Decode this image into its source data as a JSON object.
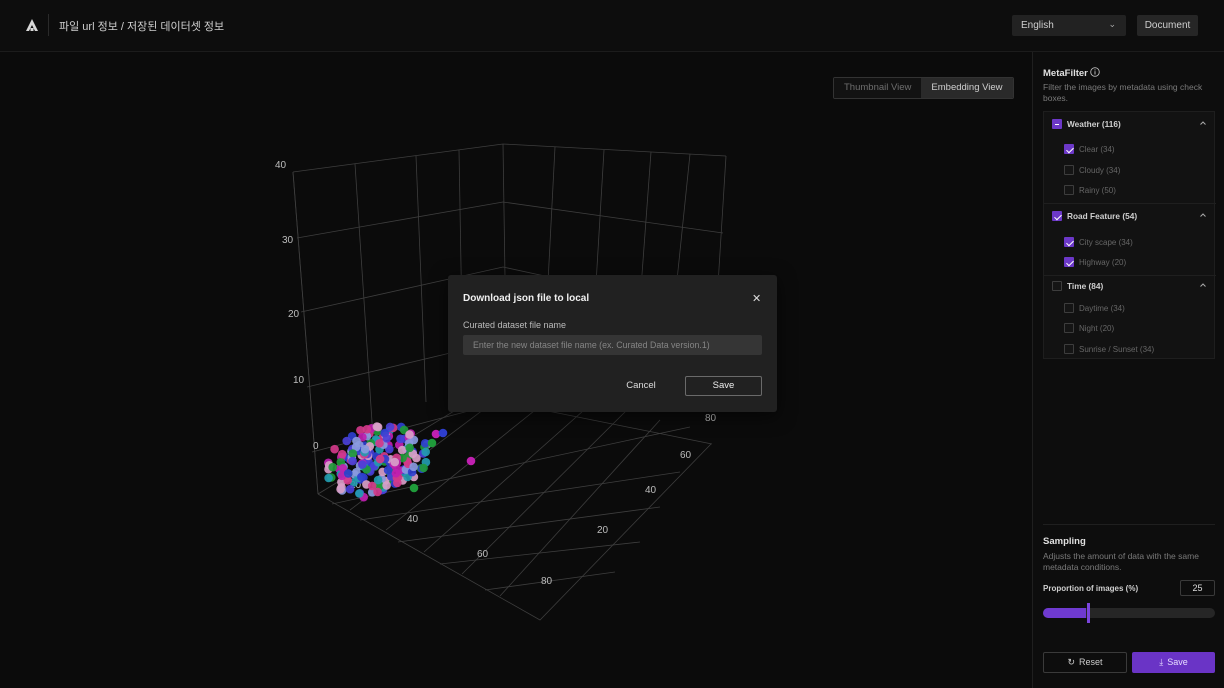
{
  "header": {
    "breadcrumb": "파일 url 정보 / 저장된 데이터셋 정보",
    "language": "English",
    "document_label": "Document"
  },
  "view_toggle": {
    "thumbnail_label": "Thumbnail View",
    "embedding_label": "Embedding View",
    "active": "Embedding View"
  },
  "chart_data": {
    "type": "scatter",
    "projection": "3d",
    "z_ticks": [
      "0",
      "10",
      "20",
      "30",
      "40"
    ],
    "x_ticks": [
      "20",
      "40",
      "60",
      "80"
    ],
    "y_ticks": [
      "20",
      "40",
      "60",
      "80"
    ],
    "grid": true,
    "series_colors": [
      "#c020b0",
      "#2f3fcf",
      "#d23a8a",
      "#4a40d8",
      "#1f9a3a",
      "#d8a0c8",
      "#8a9adf",
      "#239bb0"
    ]
  },
  "modal": {
    "title": "Download json file to local",
    "close_icon": "close-icon",
    "field_label": "Curated dataset file name",
    "field_placeholder": "Enter the new dataset file name (ex. Curated Data version.1)",
    "field_value": "",
    "cancel_label": "Cancel",
    "save_label": "Save"
  },
  "metafilter": {
    "title": "MetaFilter",
    "description": "Filter the images by metadata using check boxes.",
    "groups": [
      {
        "label": "Weather (116)",
        "state": "partial",
        "options": [
          {
            "label": "Clear (34)",
            "checked": true
          },
          {
            "label": "Cloudy (34)",
            "checked": false
          },
          {
            "label": "Rainy (50)",
            "checked": false
          }
        ]
      },
      {
        "label": "Road Feature (54)",
        "state": "checked",
        "options": [
          {
            "label": "City scape (34)",
            "checked": true
          },
          {
            "label": "Highway (20)",
            "checked": true
          }
        ]
      },
      {
        "label": "Time (84)",
        "state": "unchecked",
        "options": [
          {
            "label": "Daytime (34)",
            "checked": false
          },
          {
            "label": "Night (20)",
            "checked": false
          },
          {
            "label": "Sunrise / Sunset (34)",
            "checked": false
          }
        ]
      }
    ]
  },
  "sampling": {
    "title": "Sampling",
    "description": "Adjusts the amount of data with the same metadata conditions.",
    "proportion_label": "Proportion of images (%)",
    "proportion_value": "25",
    "proportion_fraction": 0.25
  },
  "actions": {
    "reset_label": "Reset",
    "save_label": "Save"
  },
  "colors": {
    "accent": "#6c38c8"
  }
}
